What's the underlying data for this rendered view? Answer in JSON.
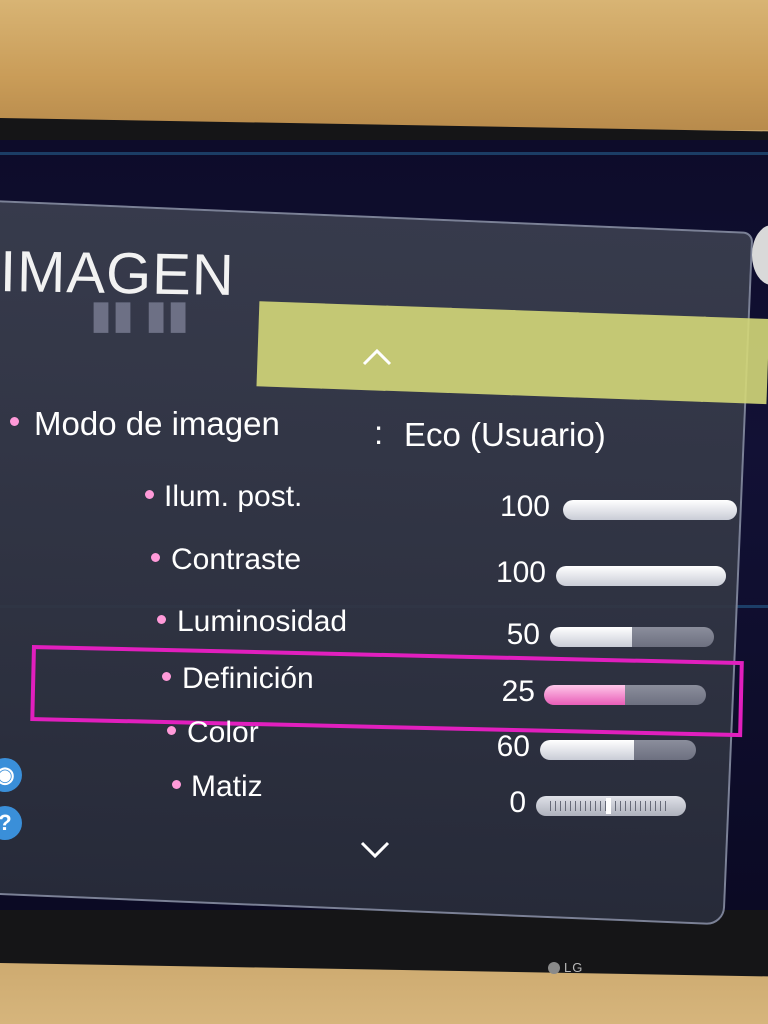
{
  "menu": {
    "title": "IMAGEN",
    "picture_mode_label": "Modo de imagen",
    "picture_mode_separator": ":",
    "picture_mode_value": "Eco (Usuario)"
  },
  "settings": [
    {
      "label": "Ilum. post.",
      "value": "100",
      "level": 1.0
    },
    {
      "label": "Contraste",
      "value": "100",
      "level": 1.0
    },
    {
      "label": "Luminosidad",
      "value": "50",
      "level": 0.5
    },
    {
      "label": "Definición",
      "value": "25",
      "level": 0.5,
      "selected": true
    },
    {
      "label": "Color",
      "value": "60",
      "level": 0.6
    },
    {
      "label": "Matiz",
      "value": "0",
      "level": 0.5
    }
  ],
  "brand": "LG",
  "colors": {
    "accent_highlight": "#e11fbe",
    "bullet": "#ff9ad9",
    "panel_bg": "#3a3e4e"
  },
  "icons": {
    "scroll_up": "chevron-up-icon",
    "scroll_down": "chevron-down-icon",
    "help": "help-icon"
  }
}
